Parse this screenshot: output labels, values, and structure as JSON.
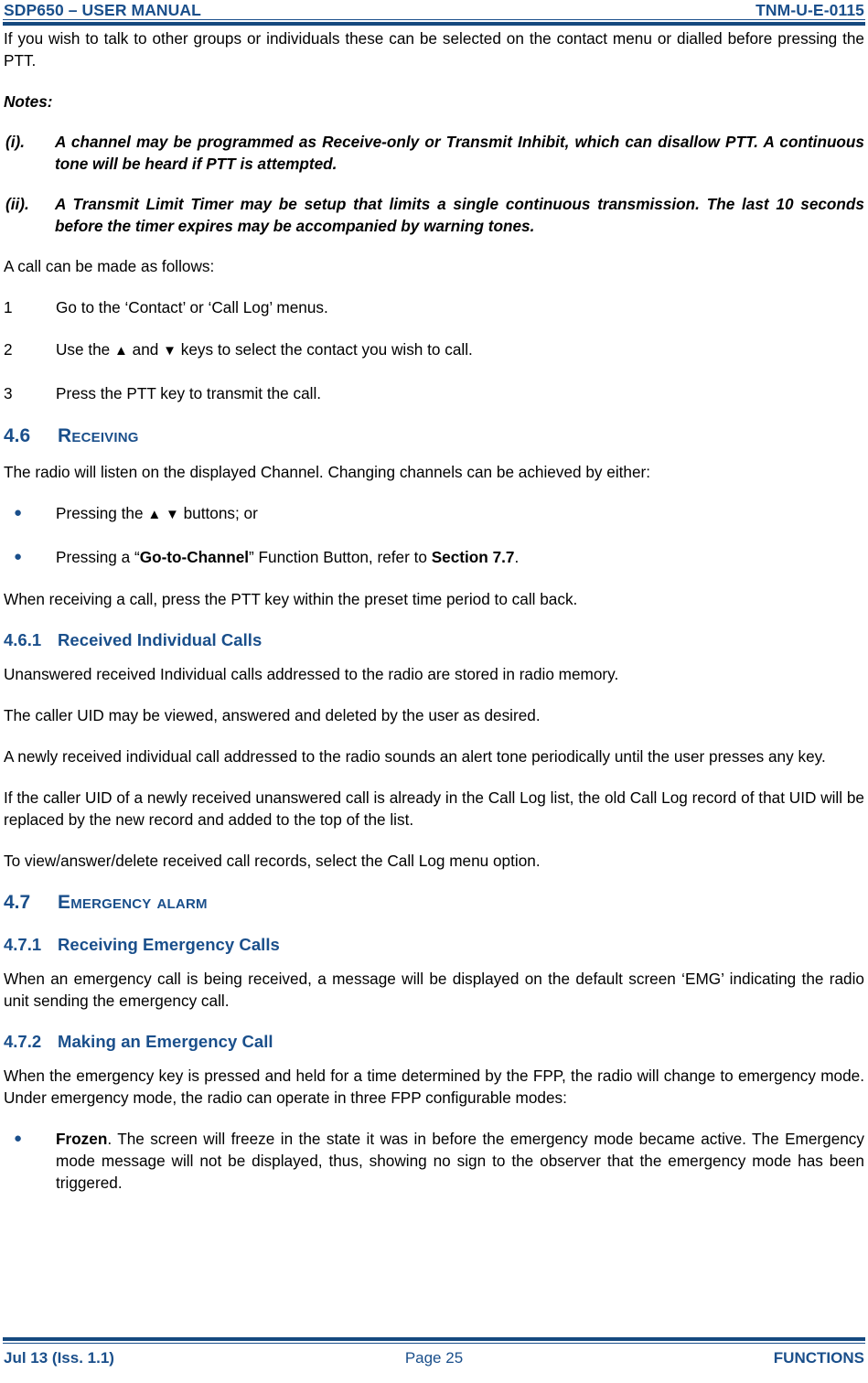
{
  "header": {
    "left": "SDP650 – USER MANUAL",
    "right": "TNM-U-E-0115"
  },
  "footer": {
    "left": "Jul 13 (Iss. 1.1)",
    "center": "Page 25",
    "right": "FUNCTIONS"
  },
  "colors": {
    "accent_blue": "#1A4F8B",
    "rule_blue": "#15497F",
    "body_black": "#000000"
  },
  "body": {
    "intro_paragraph": "If you wish to talk to other groups or individuals these can be selected on the contact menu or dialled before pressing the PTT.",
    "notes_label": "Notes:",
    "notes": [
      {
        "marker": "(i).",
        "text": "A channel may be programmed as Receive-only or Transmit Inhibit, which can disallow PTT.  A continuous tone will be heard if PTT is attempted."
      },
      {
        "marker": "(ii).",
        "text": "A Transmit Limit Timer may be setup that limits a single continuous transmission.  The last 10 seconds before the timer expires may be accompanied by warning tones."
      }
    ],
    "call_intro": "A call can be made as follows:",
    "steps": [
      {
        "number": "1",
        "text": "Go to the ‘Contact’ or ‘Call Log’ menus."
      },
      {
        "number": "2",
        "text_before": "Use the ",
        "arrow_up": "▲",
        "text_mid": " and ",
        "arrow_down": "▼",
        "text_after": " keys to select the contact you wish to call."
      },
      {
        "number": "3",
        "text": "Press the PTT key to transmit the call."
      }
    ],
    "section_4_6": {
      "number": "4.6",
      "title": "Receiving",
      "intro": "The radio will listen on the displayed Channel.  Changing channels can be achieved by either:",
      "bullets": [
        {
          "mark": "●",
          "text_before": "Pressing the ",
          "arrow_up": "▲",
          "space": " ",
          "arrow_down": "▼",
          "text_after": " buttons; or"
        },
        {
          "mark": "●",
          "text_before": "Pressing a “",
          "bold1": "Go-to-Channel",
          "text_mid": "” Function Button, refer to ",
          "bold2": "Section 7.7",
          "text_after": "."
        }
      ],
      "outro": "When receiving a call, press the PTT key within the preset time period to call back."
    },
    "section_4_6_1": {
      "number": "4.6.1",
      "title": "Received Individual Calls",
      "paragraphs": [
        "Unanswered received Individual calls addressed to the radio are stored in radio memory.",
        "The caller UID may be viewed, answered and deleted by the user as desired.",
        "A newly received individual call addressed to the radio sounds an alert tone periodically until the user presses any key.",
        "If the caller UID of a newly received unanswered call is already in the Call Log list, the old Call Log record of that UID will be replaced by the new record and added to the top of the list.",
        "To view/answer/delete received call records, select the Call Log menu option."
      ]
    },
    "section_4_7": {
      "number": "4.7",
      "title": "Emergency Alarm"
    },
    "section_4_7_1": {
      "number": "4.7.1",
      "title": "Receiving Emergency Calls",
      "paragraph": "When an emergency call is being received, a message will be displayed on the default screen ‘EMG’ indicating the radio unit sending the emergency call."
    },
    "section_4_7_2": {
      "number": "4.7.2",
      "title": "Making an Emergency Call",
      "paragraph": "When the emergency key is pressed and held for a time determined by the FPP, the radio will change to emergency mode.  Under emergency mode, the radio can operate in three FPP configurable modes:",
      "bullets": [
        {
          "mark": "●",
          "bold": "Frozen",
          "text": ".  The screen will freeze in the state it was in before the emergency mode became active.  The Emergency mode message will not be displayed, thus, showing no sign to the observer that the emergency mode has been triggered."
        }
      ]
    }
  }
}
